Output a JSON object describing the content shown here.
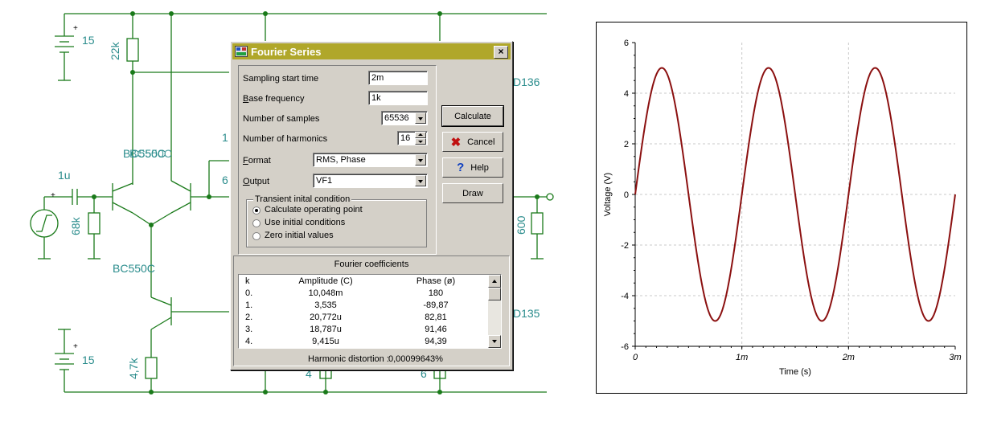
{
  "schematic": {
    "labels": [
      {
        "id": "v1",
        "text": "15"
      },
      {
        "id": "r22k",
        "text": "22k"
      },
      {
        "id": "c1u",
        "text": "1u"
      },
      {
        "id": "r68k",
        "text": "68k"
      },
      {
        "id": "q1",
        "text": "BC550C"
      },
      {
        "id": "q1b",
        "text": "BC550C"
      },
      {
        "id": "q3",
        "text": "BC550C"
      },
      {
        "id": "r47k",
        "text": "4,7k"
      },
      {
        "id": "v2",
        "text": "15"
      },
      {
        "id": "d136",
        "text": "D136"
      },
      {
        "id": "d135",
        "text": "D135"
      },
      {
        "id": "r600",
        "text": "600"
      },
      {
        "id": "p1",
        "text": "1"
      },
      {
        "id": "p6",
        "text": "6"
      },
      {
        "id": "p4",
        "text": "4"
      },
      {
        "id": "p6b",
        "text": "6"
      }
    ]
  },
  "dialog": {
    "title": "Fourier Series",
    "close": "×",
    "fields": {
      "sampling_start_label": "Sampling start time",
      "sampling_start_value": "2m",
      "base_freq_label": "Base frequency",
      "base_freq_value": "1k",
      "num_samples_label": "Number of samples",
      "num_samples_value": "65536",
      "num_harmonics_label": "Number of harmonics",
      "num_harmonics_value": "16",
      "format_label": "Format",
      "format_value": "RMS, Phase",
      "output_label": "Output",
      "output_value": "VF1"
    },
    "buttons": {
      "calculate": "Calculate",
      "cancel": "Cancel",
      "help": "Help",
      "draw": "Draw"
    },
    "transient": {
      "title": "Transient inital condition",
      "options": [
        "Calculate operating point",
        "Use initial conditions",
        "Zero initial values"
      ],
      "selected_index": 0
    },
    "coefficients": {
      "title": "Fourier coefficients",
      "headers": [
        "k",
        "Amplitude (C)",
        "Phase (ø)"
      ],
      "rows": [
        [
          "0.",
          "10,048m",
          "180"
        ],
        [
          "1.",
          "3,535",
          "-89,87"
        ],
        [
          "2.",
          "20,772u",
          "82,81"
        ],
        [
          "3.",
          "18,787u",
          "91,46"
        ],
        [
          "4.",
          "9,415u",
          "94,39"
        ]
      ]
    },
    "distortion_label": "Harmonic distortion :",
    "distortion_value": "0,00099643%"
  },
  "chart_data": {
    "type": "line",
    "title": "",
    "xlabel": "Time (s)",
    "ylabel": "Voltage (V)",
    "xlim": [
      0,
      3
    ],
    "ylim": [
      -6,
      6
    ],
    "x_ticks": [
      "0",
      "1m",
      "2m",
      "3m"
    ],
    "y_ticks": [
      "-6",
      "-4",
      "-2",
      "0",
      "2",
      "4",
      "6"
    ],
    "grid": true,
    "series": [
      {
        "color": "#8b1010",
        "amplitude": 5,
        "frequency_per_ms": 1,
        "x_unit": "ms"
      }
    ]
  }
}
